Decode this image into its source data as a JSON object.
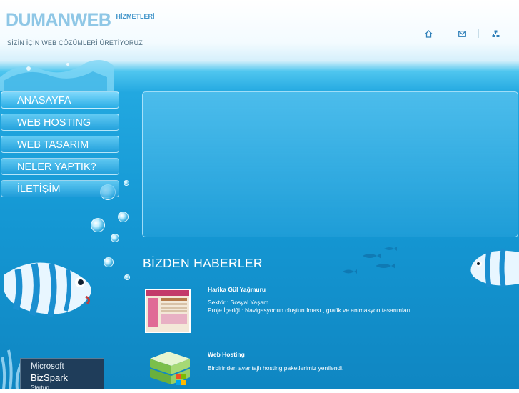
{
  "header": {
    "logo_main": "DUMANWEB",
    "logo_sub": "HİZMETLERİ",
    "slogan": "SİZİN İÇİN WEB ÇÖZÜMLERİ ÜRETİYORUZ",
    "icons": [
      "home-icon",
      "mail-icon",
      "sitemap-icon"
    ]
  },
  "nav": {
    "items": [
      {
        "label": "ANASAYFA"
      },
      {
        "label": "WEB HOSTING"
      },
      {
        "label": "WEB TASARIM"
      },
      {
        "label": "NELER YAPTIK?"
      },
      {
        "label": "İLETİŞİM"
      }
    ]
  },
  "news": {
    "title": "BİZDEN HABERLER",
    "items": [
      {
        "headline": "Harika Gül Yağmuru",
        "line1": "Sektör : Sosyal Yaşam",
        "line2": "Proje İçeriği : Navigasyonun oluşturulması , grafik ve animasyon tasarımları",
        "thumb": "website-thumbnail"
      },
      {
        "headline": "Web Hosting",
        "line1": "Birbirinden avantajlı hosting paketlerimiz yenilendi.",
        "thumb": "server-stack-icon"
      }
    ]
  },
  "badge": {
    "line1": "Microsoft",
    "line2": "BizSpark",
    "line3": "Startup"
  },
  "colors": {
    "ocean": "#1598d4",
    "nav_fill": "#2aaee6",
    "logo": "#8fc7e6"
  }
}
